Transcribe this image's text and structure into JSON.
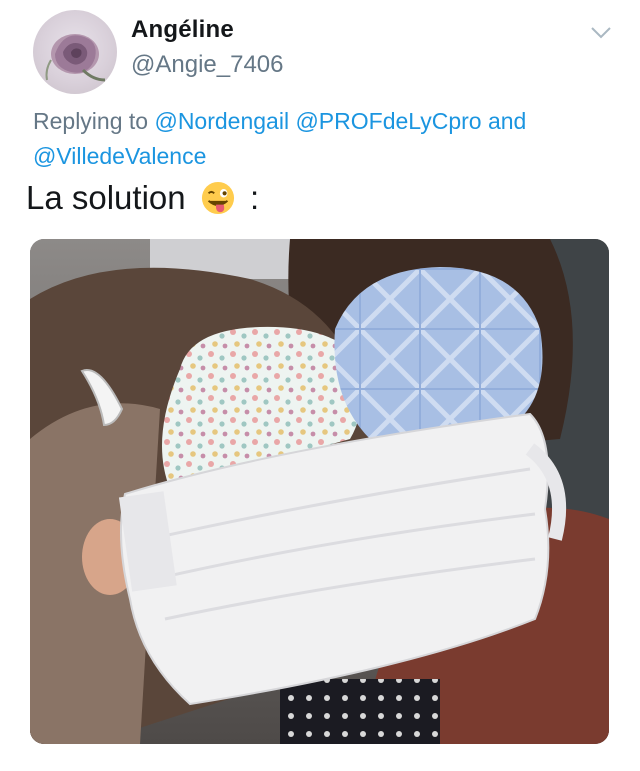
{
  "tweet": {
    "author": {
      "display_name": "Angéline",
      "handle": "@Angie_7406",
      "avatar_icon": "rose-avatar-icon"
    },
    "menu_icon": "chevron-down-icon",
    "reply": {
      "prefix": "Replying to",
      "mentions": [
        "@Nordengail",
        "@PROFdeLyCpro",
        "@VilledeValence"
      ],
      "conjunction": "and"
    },
    "text": {
      "before_emoji": "La solution",
      "emoji": "winking-face-with-tongue-icon",
      "after_emoji": ":"
    },
    "media": {
      "type": "photo"
    }
  },
  "colors": {
    "link": "#1b95e0",
    "secondary_text": "#657786",
    "primary_text": "#14171a"
  }
}
